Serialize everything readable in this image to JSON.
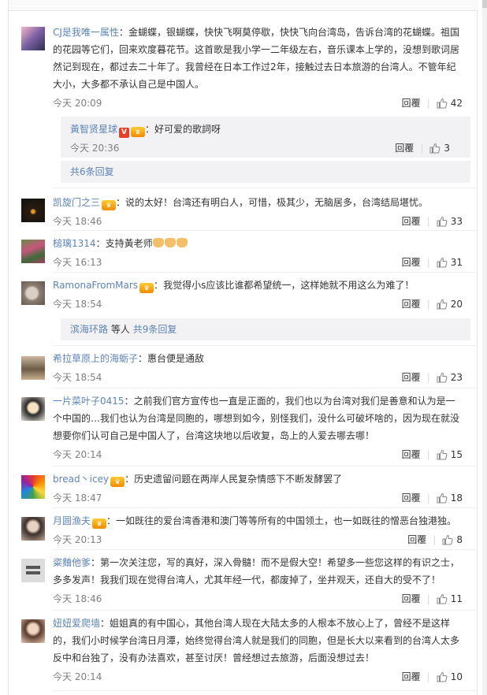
{
  "comments": [
    {
      "user": "CJ是我唯一属性",
      "text": "金蝴蝶，银蝴蝶，快快飞啊莫停歇，快快飞向台湾岛，告诉台湾的花蝴蝶。祖国的花园等它们，回来欢度暮花节。这首歌是我小学一二年级左右，音乐课本上学的，没想到歌词居然记到现在，都过去二十年了。我曾经在日本工作过2年，接触过去日本旅游的台湾人。不管年纪大小，大多都不承认自己是中国人。",
      "time": "今天 20:09",
      "reply": "回覆",
      "likes": "42",
      "sub_replies": [
        {
          "user": "黃智贤星球",
          "text": "好可爱的歌詞呀",
          "time": "今天 20:36",
          "reply": "回覆",
          "likes": "3"
        }
      ],
      "more": "共6条回复"
    },
    {
      "user": "凯旋门之三",
      "text": "说的太好！台湾还有明白人，可惜，极其少，无脑居多，台湾结局堪忧。",
      "time": "今天 18:46",
      "reply": "回覆",
      "likes": "33"
    },
    {
      "user": "槌璃1314",
      "text": "支持黃老师",
      "time": "今天 16:13",
      "reply": "回覆",
      "likes": "31"
    },
    {
      "user": "RamonaFromMars",
      "text": "我觉得小s应该比谁都希望统一，这样她就不用这么为难了！",
      "time": "今天 18:54",
      "reply": "回覆",
      "likes": "20",
      "more_user": "滨海环路",
      "more_mid": "等人",
      "more_link": "共9条回复"
    },
    {
      "user": "希拉草原上的海蛎子",
      "text": "惠台便是通敌",
      "time": "今天 18:54",
      "reply": "回覆",
      "likes": "23"
    },
    {
      "user": "一片菜叶子0415",
      "text": "之前我们官方宣传也一直是正面的，我们也以为台湾对我们是善意和认为是一个中国的…我们也认为台湾是同胞的，哪想到如今，别怪我们，没什么可破坏啥的，因为现在就没想要你们认可自己是中国人了，台湾这块地以后收复，岛上的人爱去哪去哪！",
      "time": "今天 20:14",
      "reply": "回覆",
      "likes": "15"
    },
    {
      "user": "bread丶icey",
      "text": "历史遗留问题在两岸人民复杂情感下不断发酵罢了",
      "time": "今天 18:47",
      "reply": "回覆",
      "likes": "18"
    },
    {
      "user": "月圆渔夫",
      "text": "一如既往的爱台湾香港和澳门等等所有的中国领土，也一如既往的憎恶台独港独。",
      "time": "今天 20:13",
      "reply": "回覆",
      "likes": "8"
    },
    {
      "user": "粢麯他爹",
      "text": "第一次关注您，写的真好，深入骨髓！而不是假大空！希望多一些您这样的有识之士，多多发声！我我们现在觉得台湾人，尤其年经一代，都废掉了，坐井观天，还自大的受不了！",
      "time": "今天 18:46",
      "reply": "回覆",
      "likes": "11"
    },
    {
      "user": "妞妞爱爬墙",
      "text": "姐姐真的有中国心，其他台湾人现在大陆太多的人根本不放心上了，曾经不是这样的，我们小时候学台湾日月潭，始终觉得台湾人就是我们的同胞，但是长大以来看到的台湾人太多反中和台独了，没有办法喜欢，甚至讨厌！曾经想过去旅游，后面没想过去！",
      "time": "今天 20:14",
      "reply": "回覆",
      "likes": "10"
    }
  ],
  "colors": {
    "link": "#5d84b5",
    "meta": "#808080",
    "subbox": "#f2f2f5"
  },
  "icons": {
    "like": "thumbs-up-icon"
  }
}
